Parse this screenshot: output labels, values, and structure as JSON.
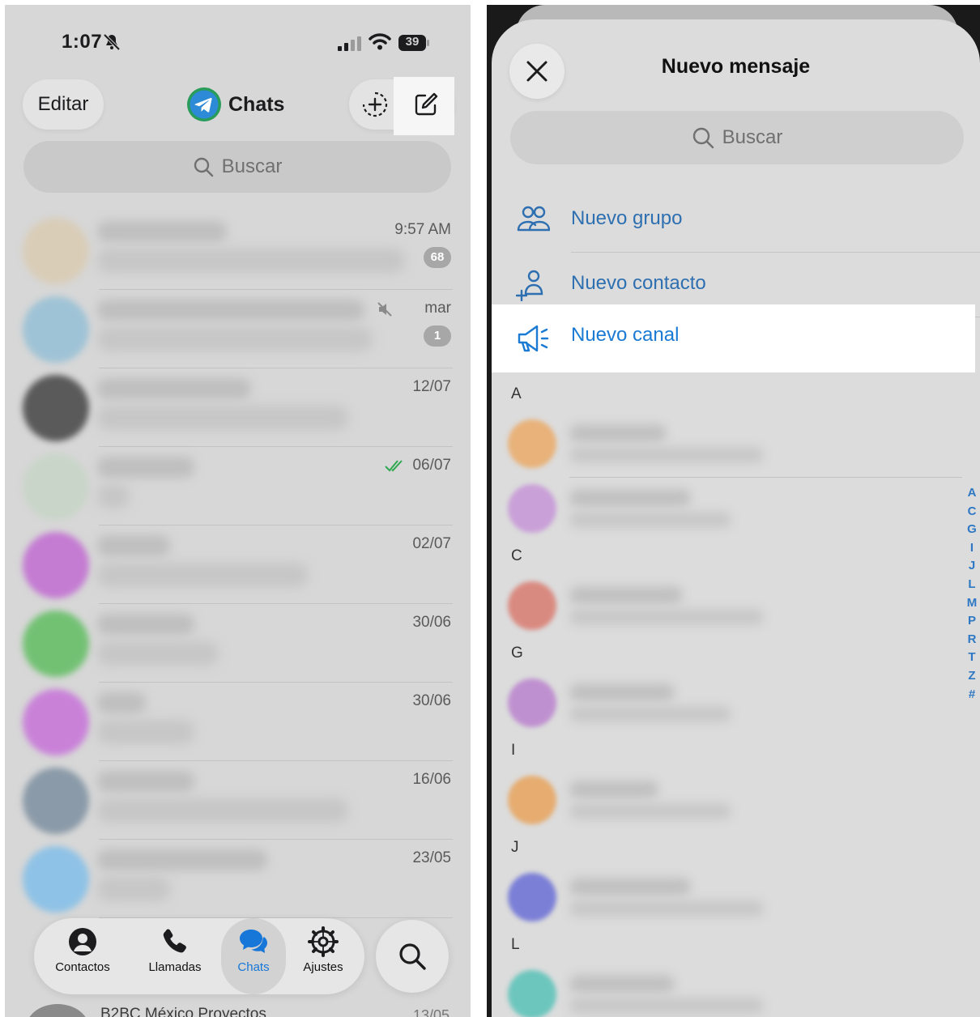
{
  "left_screen": {
    "status_bar": {
      "time": "1:07",
      "battery": "39"
    },
    "header": {
      "edit_label": "Editar",
      "title": "Chats"
    },
    "search": {
      "placeholder": "Buscar"
    },
    "chats": [
      {
        "date": "9:57 AM",
        "badge": "68",
        "avatar_color": "#d9cdb8"
      },
      {
        "date": "mar",
        "badge": "1",
        "avatar_color": "#9fc3d6",
        "muted": true
      },
      {
        "date": "12/07",
        "badge": "",
        "avatar_color": "#5a5a5a"
      },
      {
        "date": "06/07",
        "badge": "",
        "avatar_color": "#c9d5c9",
        "read_check": true
      },
      {
        "date": "02/07",
        "badge": "",
        "avatar_color": "#c47bd2"
      },
      {
        "date": "30/06",
        "badge": "",
        "avatar_color": "#72c173"
      },
      {
        "date": "30/06",
        "badge": "",
        "avatar_color": "#c981d8"
      },
      {
        "date": "16/06",
        "badge": "",
        "avatar_color": "#8a9aa8"
      },
      {
        "date": "23/05",
        "badge": "",
        "avatar_color": "#8ec2e6"
      }
    ],
    "peek_chat": {
      "name": "B2BC México Proyectos",
      "date": "13/05"
    },
    "tabbar": {
      "contacts": "Contactos",
      "calls": "Llamadas",
      "chats": "Chats",
      "settings": "Ajustes"
    },
    "accent_color": "#1677d8"
  },
  "right_screen": {
    "title": "Nuevo mensaje",
    "search": {
      "placeholder": "Buscar"
    },
    "actions": {
      "new_group": "Nuevo grupo",
      "new_contact": "Nuevo contacto",
      "new_channel": "Nuevo canal"
    },
    "sections": [
      {
        "letter": "A",
        "avatar_colors": [
          "#e8b27a",
          "#c9a0d8"
        ]
      },
      {
        "letter": "C",
        "avatar_colors": [
          "#d98a80"
        ]
      },
      {
        "letter": "G",
        "avatar_colors": [
          "#bf90d0"
        ]
      },
      {
        "letter": "I",
        "avatar_colors": [
          "#e6ac70"
        ]
      },
      {
        "letter": "J",
        "avatar_colors": [
          "#7b7fd6"
        ]
      },
      {
        "letter": "L",
        "avatar_colors": [
          "#6cc6bd"
        ]
      }
    ],
    "alphabet_index": [
      "A",
      "C",
      "G",
      "I",
      "J",
      "L",
      "M",
      "P",
      "R",
      "T",
      "Z",
      "#"
    ],
    "link_color": "#2d6fb0"
  }
}
